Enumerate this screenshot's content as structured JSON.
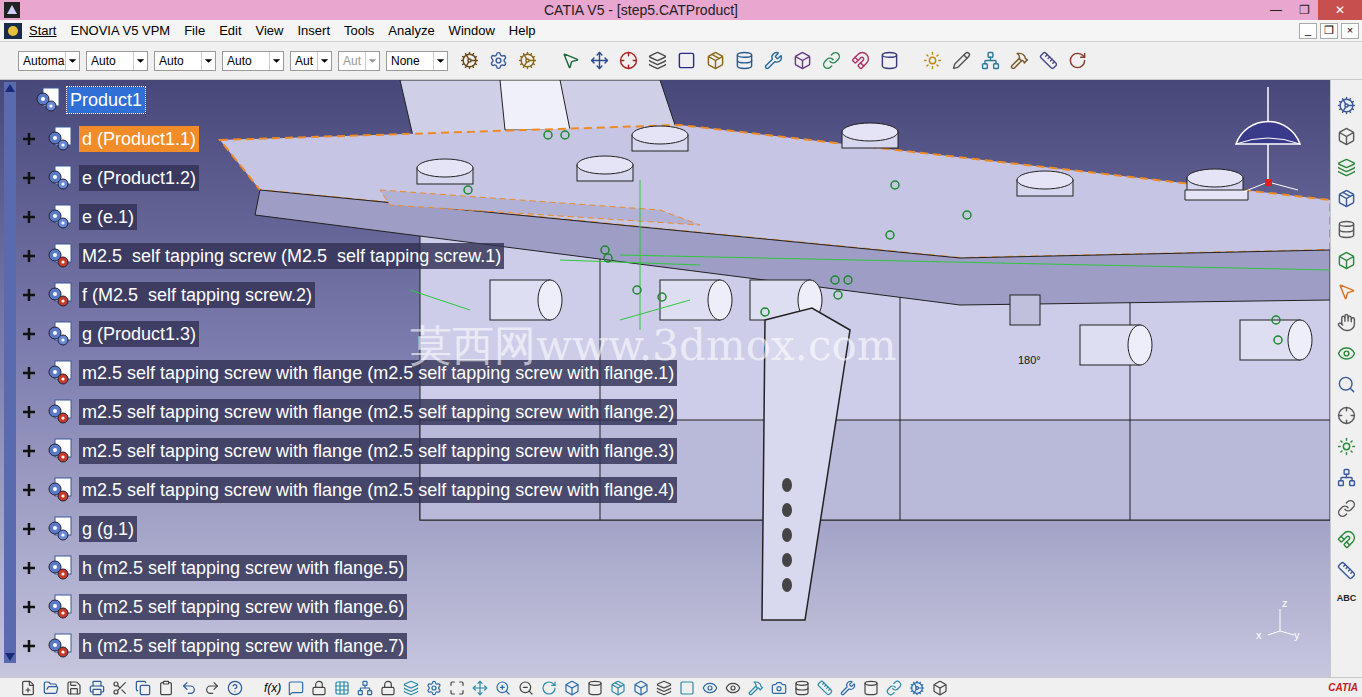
{
  "window": {
    "title": "CATIA V5 - [step5.CATProduct]",
    "controls": [
      "—",
      "❐",
      "✕"
    ]
  },
  "menu": {
    "items": [
      "Start",
      "ENOVIA V5 VPM",
      "File",
      "Edit",
      "View",
      "Insert",
      "Tools",
      "Analyze",
      "Window",
      "Help"
    ],
    "mdi_controls": [
      "_",
      "❐",
      "×"
    ]
  },
  "toolbar": {
    "dropdowns": [
      {
        "value": "Automa",
        "disabled": false
      },
      {
        "value": "Auto",
        "disabled": false
      },
      {
        "value": "Auto",
        "disabled": false
      },
      {
        "value": "Auto",
        "disabled": false
      },
      {
        "value": "Aut",
        "disabled": false
      },
      {
        "value": "Aut",
        "disabled": true
      },
      {
        "value": "None",
        "disabled": false
      }
    ]
  },
  "tree": {
    "items": [
      {
        "label": "Product1",
        "kind": "root",
        "selected": true,
        "highlighted": false
      },
      {
        "label": "d (Product1.1)",
        "kind": "product",
        "selected": false,
        "highlighted": true
      },
      {
        "label": "e (Product1.2)",
        "kind": "product",
        "selected": false,
        "highlighted": false
      },
      {
        "label": "e (e.1)",
        "kind": "product",
        "selected": false,
        "highlighted": false
      },
      {
        "label": "M2.5  self tapping screw (M2.5  self tapping screw.1)",
        "kind": "part",
        "selected": false,
        "highlighted": false
      },
      {
        "label": "f (M2.5  self tapping screw.2)",
        "kind": "part",
        "selected": false,
        "highlighted": false
      },
      {
        "label": "g (Product1.3)",
        "kind": "product",
        "selected": false,
        "highlighted": false
      },
      {
        "label": "m2.5 self tapping screw with flange (m2.5 self tapping screw with flange.1)",
        "kind": "part",
        "selected": false,
        "highlighted": false
      },
      {
        "label": "m2.5 self tapping screw with flange (m2.5 self tapping screw with flange.2)",
        "kind": "part",
        "selected": false,
        "highlighted": false
      },
      {
        "label": "m2.5 self tapping screw with flange (m2.5 self tapping screw with flange.3)",
        "kind": "part",
        "selected": false,
        "highlighted": false
      },
      {
        "label": "m2.5 self tapping screw with flange (m2.5 self tapping screw with flange.4)",
        "kind": "part",
        "selected": false,
        "highlighted": false
      },
      {
        "label": "g (g.1)",
        "kind": "product",
        "selected": false,
        "highlighted": false
      },
      {
        "label": "h (m2.5 self tapping screw with flange.5)",
        "kind": "part",
        "selected": false,
        "highlighted": false
      },
      {
        "label": "h (m2.5 self tapping screw with flange.6)",
        "kind": "part",
        "selected": false,
        "highlighted": false
      },
      {
        "label": "h (m2.5 self tapping screw with flange.7)",
        "kind": "part",
        "selected": false,
        "highlighted": false
      }
    ]
  },
  "viewport": {
    "watermark": "莫西网www.3dmox.com",
    "annotation": "180°",
    "axes": [
      "z",
      "x",
      "y"
    ]
  },
  "right_toolbar": {
    "label": "ABC"
  },
  "bottom_toolbar": {
    "label": "f(x)",
    "logo": "CATIA"
  }
}
